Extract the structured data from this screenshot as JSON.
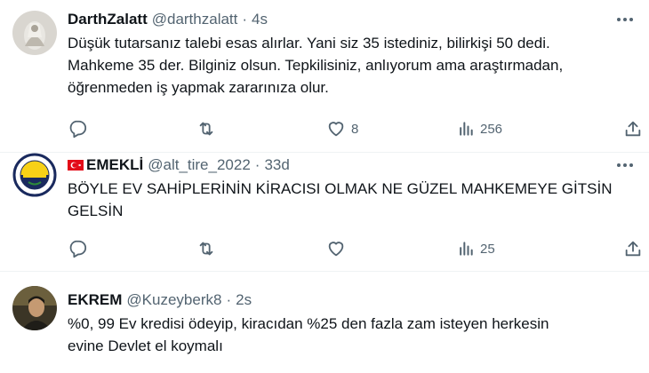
{
  "tweets": [
    {
      "display_name": "DarthZalatt",
      "handle": "@darthzalatt",
      "time": "4s",
      "lines": [
        "Düşük tutarsanız talebi esas alırlar. Yani siz 35 istediniz, bilirkişi 50 dedi.",
        "Mahkeme 35 der. Bilginiz olsun. Tepkilisiniz, anlıyorum ama araştırmadan,",
        "öğrenmeden iş yapmak zararınıza olur."
      ],
      "likes": "8",
      "views": "256"
    },
    {
      "display_name": "EMEKLİ",
      "handle": "@alt_tire_2022",
      "time": "33d",
      "lines": [
        "BÖYLE EV SAHİPLERİNİN KİRACISI OLMAK NE GÜZEL MAHKEMEYE GİTSİN",
        "GELSİN"
      ],
      "likes": "",
      "views": "25"
    },
    {
      "display_name": "EKREM",
      "handle": "@Kuzeyberk8",
      "time": "2s",
      "lines": [
        "%0, 99 Ev kredisi ödeyip, kiracıdan %25 den fazla zam isteyen herkesin",
        "evine Devlet el koymalı"
      ]
    }
  ],
  "separator": "·",
  "icons": {
    "reply": "reply-icon",
    "retweet": "retweet-icon",
    "like": "heart-icon",
    "views": "views-icon",
    "share": "share-icon",
    "more": "more-icon",
    "flag": "turkey-flag-icon"
  },
  "colors": {
    "text": "#0f1419",
    "secondary": "#536471",
    "divider": "#eff3f4",
    "flag_red": "#e30a17"
  }
}
